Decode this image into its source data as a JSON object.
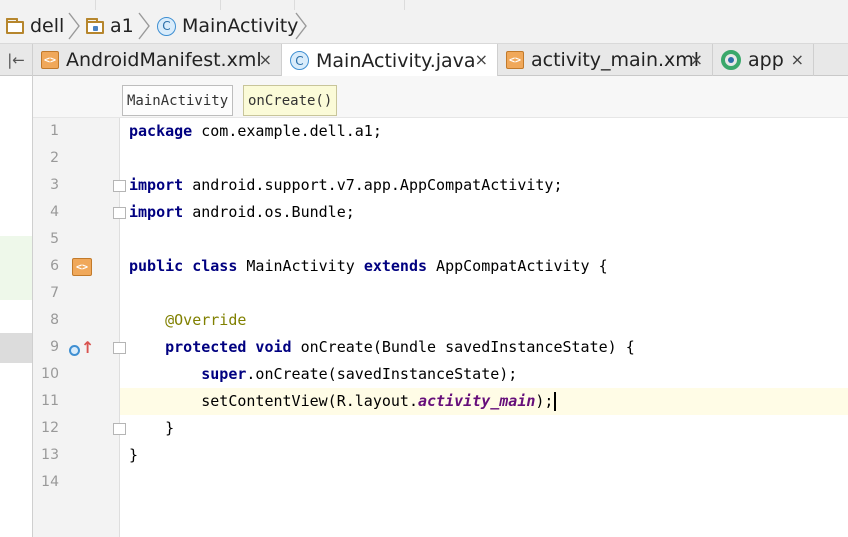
{
  "breadcrumb": {
    "items": [
      {
        "label": "dell",
        "icon": "folder-icon"
      },
      {
        "label": "a1",
        "icon": "package-icon"
      },
      {
        "label": "MainActivity",
        "icon": "class-icon"
      }
    ]
  },
  "tabs": [
    {
      "label": "AndroidManifest.xml",
      "icon": "xml-file-icon",
      "active": false
    },
    {
      "label": "MainActivity.java",
      "icon": "class-icon",
      "active": true
    },
    {
      "label": "activity_main.xml",
      "icon": "xml-file-icon",
      "active": false
    },
    {
      "label": "app",
      "icon": "gradle-module-icon",
      "active": false
    }
  ],
  "tab_close_glyph": "×",
  "structure": {
    "class_label": "MainActivity",
    "method_label": "onCreate()"
  },
  "editor": {
    "current_line": 11,
    "lines": [
      {
        "n": "1",
        "tokens": [
          {
            "t": "package",
            "c": "kw"
          },
          {
            "t": " com.example.dell.a1;"
          }
        ]
      },
      {
        "n": "2",
        "tokens": []
      },
      {
        "n": "3",
        "tokens": [
          {
            "t": "import",
            "c": "kw"
          },
          {
            "t": " android.support.v7.app.AppCompatActivity;"
          }
        ]
      },
      {
        "n": "4",
        "tokens": [
          {
            "t": "import",
            "c": "kw"
          },
          {
            "t": " android.os.Bundle;"
          }
        ]
      },
      {
        "n": "5",
        "tokens": []
      },
      {
        "n": "6",
        "tokens": [
          {
            "t": "public class",
            "c": "kw"
          },
          {
            "t": " MainActivity "
          },
          {
            "t": "extends",
            "c": "kw"
          },
          {
            "t": " AppCompatActivity {"
          }
        ]
      },
      {
        "n": "7",
        "tokens": []
      },
      {
        "n": "8",
        "tokens": [
          {
            "t": "    "
          },
          {
            "t": "@Override",
            "c": "anno"
          }
        ]
      },
      {
        "n": "9",
        "tokens": [
          {
            "t": "    "
          },
          {
            "t": "protected void",
            "c": "kw"
          },
          {
            "t": " onCreate(Bundle savedInstanceState) {"
          }
        ]
      },
      {
        "n": "10",
        "tokens": [
          {
            "t": "        "
          },
          {
            "t": "super",
            "c": "kw"
          },
          {
            "t": ".onCreate(savedInstanceState);"
          }
        ]
      },
      {
        "n": "11",
        "tokens": [
          {
            "t": "        setContentView(R.layout."
          },
          {
            "t": "activity_main",
            "c": "ital"
          },
          {
            "t": ");"
          }
        ]
      },
      {
        "n": "12",
        "tokens": [
          {
            "t": "    }"
          }
        ]
      },
      {
        "n": "13",
        "tokens": [
          {
            "t": "}"
          }
        ]
      },
      {
        "n": "14",
        "tokens": []
      }
    ]
  },
  "colors": {
    "keyword": "#000080",
    "annotation": "#808000",
    "constant": "#660e7a",
    "current_line": "#fffce6"
  }
}
